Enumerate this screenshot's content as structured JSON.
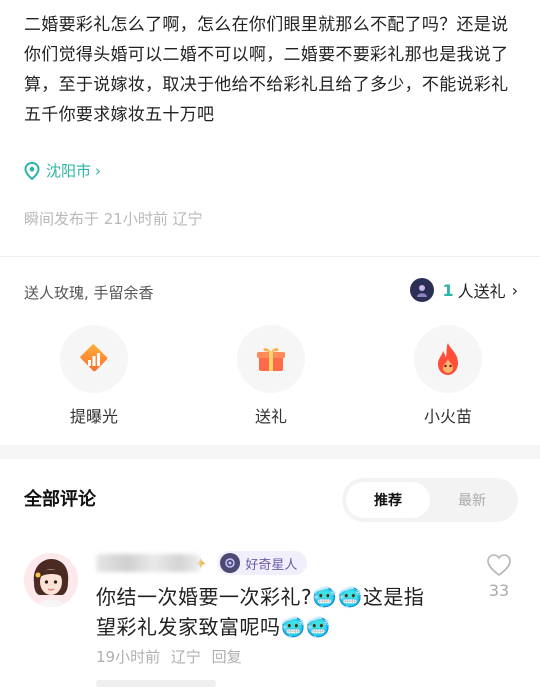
{
  "post": {
    "text": "二婚要彩礼怎么了啊，怎么在你们眼里就那么不配了吗？还是说你们觉得头婚可以二婚不可以啊，二婚要不要彩礼那也是我说了算，至于说嫁妆，取决于他给不给彩礼且给了多少，不能说彩礼五千你要求嫁妆五十万吧",
    "location": "沈阳市",
    "meta": "瞬间发布于 21小时前 辽宁"
  },
  "gifts": {
    "hint": "送人玫瑰, 手留余香",
    "count": "1",
    "count_suffix": "人送礼",
    "actions": [
      {
        "label": "提曝光",
        "icon": "boost-icon"
      },
      {
        "label": "送礼",
        "icon": "gift-icon"
      },
      {
        "label": "小火苗",
        "icon": "flame-icon"
      }
    ]
  },
  "comments": {
    "title": "全部评论",
    "sort": {
      "active": "推荐",
      "inactive": "最新"
    },
    "items": [
      {
        "badge": "好奇星人",
        "text": "你结一次婚要一次彩礼?🥶🥶这是指望彩礼发家致富呢吗🥶🥶",
        "time": "19小时前",
        "region": "辽宁",
        "reply": "回复",
        "likes": "33"
      }
    ]
  },
  "colors": {
    "accent": "#2bb5a6",
    "flame": "#ff4d3a",
    "gift": "#ff6a4a"
  }
}
